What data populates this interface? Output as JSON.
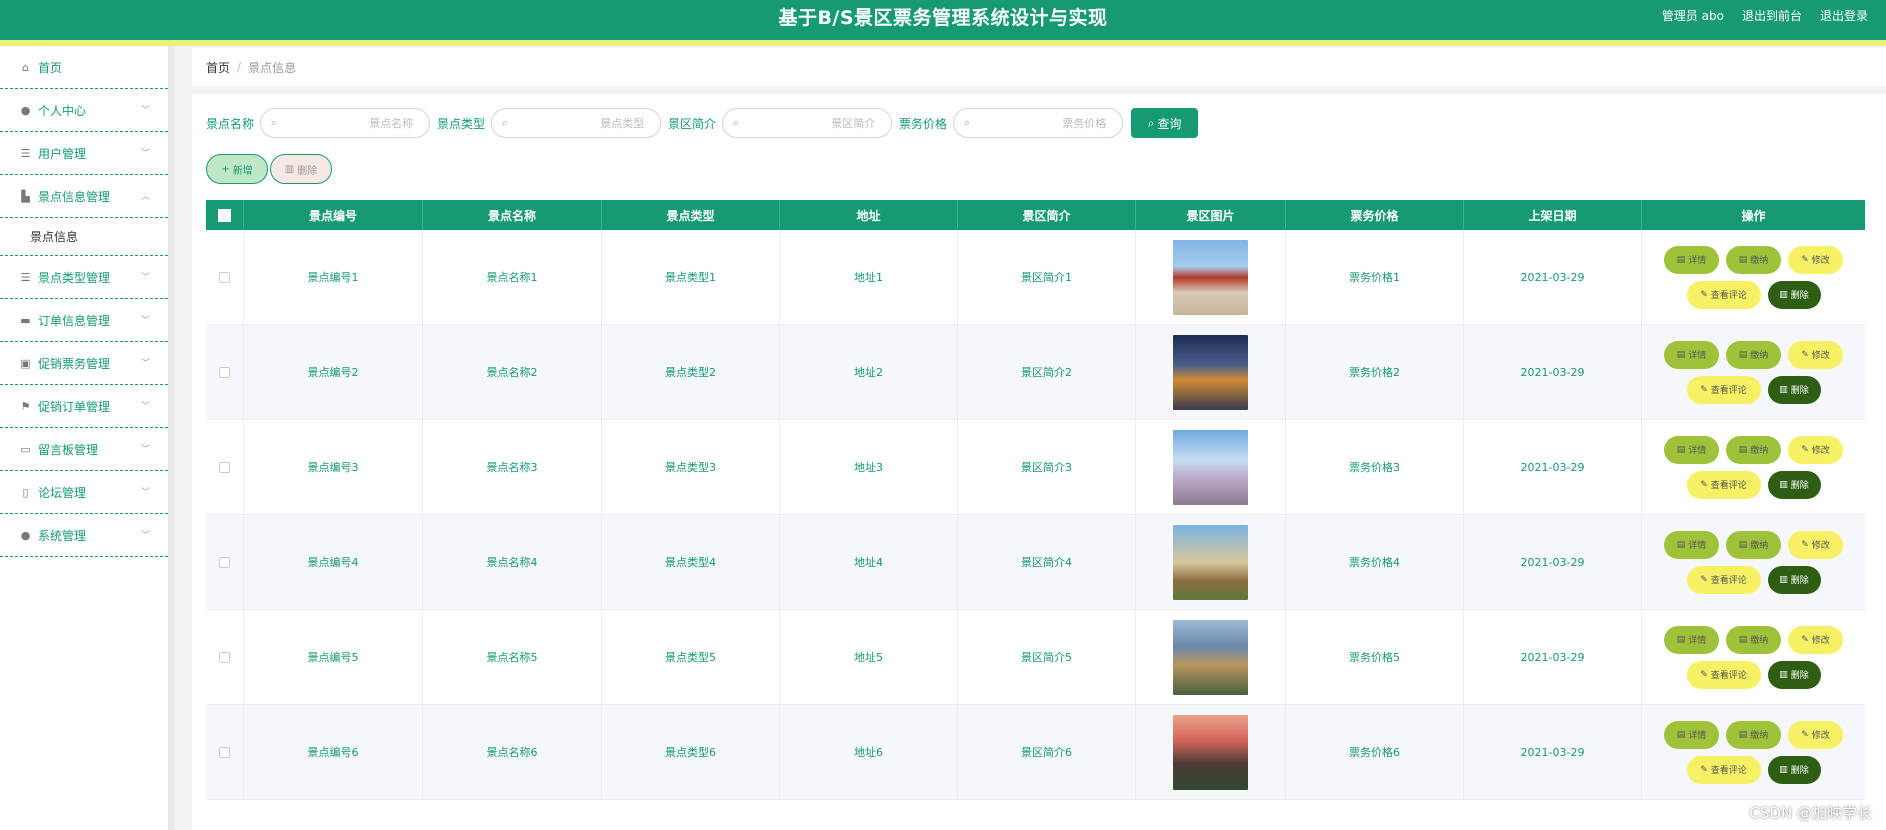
{
  "header": {
    "title": "基于B/S景区票务管理系统设计与实现",
    "links": [
      "管理员 abo",
      "退出到前台",
      "退出登录"
    ]
  },
  "sidebar": {
    "items": [
      {
        "label": "首页",
        "icon": "home-icon",
        "glyph": "⌂",
        "chevron": false
      },
      {
        "label": "个人中心",
        "icon": "user-icon",
        "glyph": "●",
        "chevron": true
      },
      {
        "label": "用户管理",
        "icon": "list-icon",
        "glyph": "☰",
        "chevron": true
      },
      {
        "label": "景点信息管理",
        "icon": "building-icon",
        "glyph": "▙",
        "chevron": true,
        "expanded": true,
        "sub": "景点信息"
      },
      {
        "label": "景点类型管理",
        "icon": "menu-icon",
        "glyph": "☰",
        "chevron": true
      },
      {
        "label": "订单信息管理",
        "icon": "printer-icon",
        "glyph": "▬",
        "chevron": true
      },
      {
        "label": "促销票务管理",
        "icon": "clipboard-check-icon",
        "glyph": "▣",
        "chevron": true
      },
      {
        "label": "促销订单管理",
        "icon": "flag-icon",
        "glyph": "⚑",
        "chevron": true
      },
      {
        "label": "留言板管理",
        "icon": "monitor-icon",
        "glyph": "▭",
        "chevron": true
      },
      {
        "label": "论坛管理",
        "icon": "forum-icon",
        "glyph": "▯",
        "chevron": true
      },
      {
        "label": "系统管理",
        "icon": "system-user-icon",
        "glyph": "●",
        "chevron": true
      }
    ]
  },
  "breadcrumb": {
    "home": "首页",
    "separator": "/",
    "current": "景点信息"
  },
  "search": {
    "fields": [
      {
        "label": "景点名称",
        "placeholder": "景点名称"
      },
      {
        "label": "景点类型",
        "placeholder": "景点类型"
      },
      {
        "label": "景区简介",
        "placeholder": "景区简介"
      },
      {
        "label": "票务价格",
        "placeholder": "票务价格"
      }
    ],
    "button": "查询"
  },
  "actions": {
    "add": "新增",
    "delete": "删除"
  },
  "table": {
    "headers": [
      "景点编号",
      "景点名称",
      "景点类型",
      "地址",
      "景区简介",
      "景区图片",
      "票务价格",
      "上架日期",
      "操作"
    ],
    "rows": [
      {
        "id": "景点编号1",
        "name": "景点名称1",
        "type": "景点类型1",
        "addr": "地址1",
        "intro": "景区简介1",
        "price": "票务价格1",
        "date": "2021-03-29",
        "pic": "pagoda-photo"
      },
      {
        "id": "景点编号2",
        "name": "景点名称2",
        "type": "景点类型2",
        "addr": "地址2",
        "intro": "景区简介2",
        "price": "票务价格2",
        "date": "2021-03-29",
        "pic": "harbor-photo"
      },
      {
        "id": "景点编号3",
        "name": "景点名称3",
        "type": "景点类型3",
        "addr": "地址3",
        "intro": "景区简介3",
        "price": "票务价格3",
        "date": "2021-03-29",
        "pic": "castle-photo"
      },
      {
        "id": "景点编号4",
        "name": "景点名称4",
        "type": "景点类型4",
        "addr": "地址4",
        "intro": "景区简介4",
        "price": "票务价格4",
        "date": "2021-03-29",
        "pic": "tower-photo"
      },
      {
        "id": "景点编号5",
        "name": "景点名称5",
        "type": "景点类型5",
        "addr": "地址5",
        "intro": "景区简介5",
        "price": "票务价格5",
        "date": "2021-03-29",
        "pic": "cliff-photo"
      },
      {
        "id": "景点编号6",
        "name": "景点名称6",
        "type": "景点类型6",
        "addr": "地址6",
        "intro": "景区简介6",
        "price": "票务价格6",
        "date": "2021-03-29",
        "pic": "pavilion-photo"
      }
    ],
    "ops": {
      "detail": "详情",
      "pay": "缴纳",
      "edit": "修改",
      "comment": "查看评论",
      "delete": "删除"
    }
  },
  "watermark": "CSDN @加映学长",
  "colors": {
    "primary": "#159a73",
    "strip": "#e9f37a",
    "op_green": "#9ec33a",
    "op_yellow": "#f6f065",
    "op_dark": "#2d5e14"
  }
}
